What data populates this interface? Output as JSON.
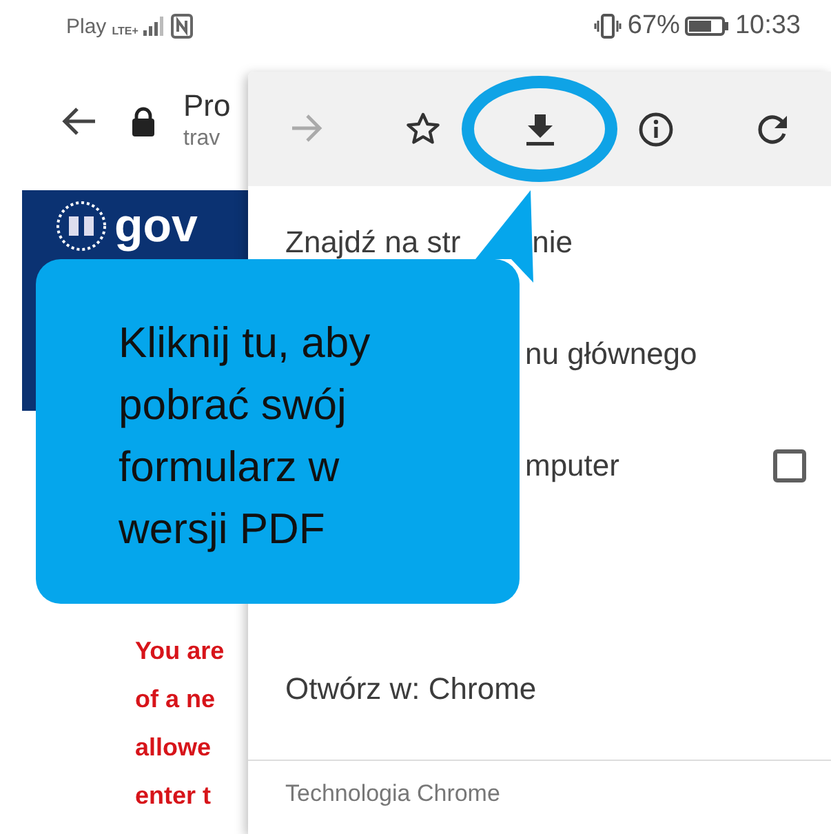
{
  "status_bar": {
    "carrier": "Play",
    "network": "LTE+",
    "battery": "67%",
    "time": "10:33"
  },
  "page": {
    "title": "Pro",
    "url": "trav",
    "logo_text": "gov",
    "warning_lines": [
      "You are",
      "of a ne",
      "allowe",
      "enter t"
    ]
  },
  "menu": {
    "toolbar": [
      {
        "kind": "forward",
        "disabled": true,
        "highlighted": false
      },
      {
        "kind": "star",
        "disabled": false,
        "highlighted": false
      },
      {
        "kind": "download",
        "disabled": false,
        "highlighted": true
      },
      {
        "kind": "info",
        "disabled": false,
        "highlighted": false
      },
      {
        "kind": "reload",
        "disabled": false,
        "highlighted": false
      }
    ],
    "items": [
      {
        "kind": "split",
        "label": "Znajdź na str",
        "label_after": "nie"
      },
      {
        "kind": "plain",
        "label": "nu głównego"
      },
      {
        "kind": "checkbox",
        "label": "mputer",
        "checked": false
      },
      {
        "kind": "plain",
        "label": "Otwórz w: Chrome"
      }
    ],
    "footer": "Technologia Chrome"
  },
  "callout": {
    "text": "Kliknij tu, aby pobrać swój formularz w wersji PDF"
  }
}
